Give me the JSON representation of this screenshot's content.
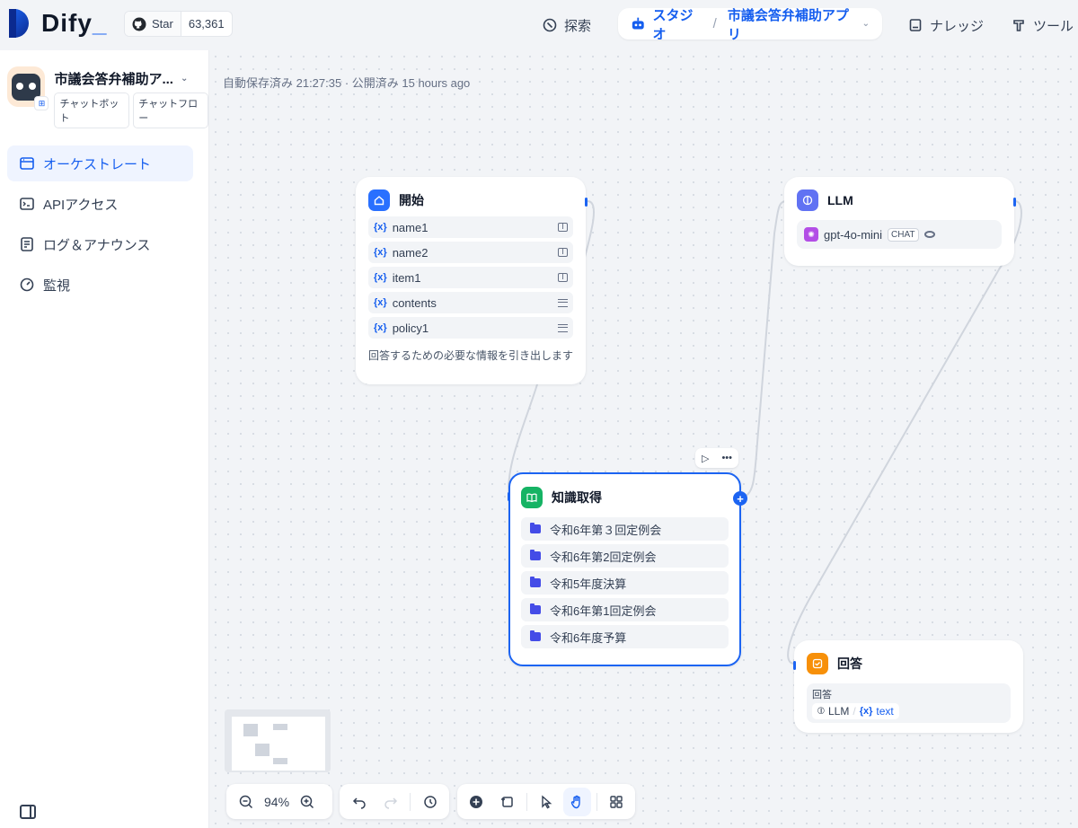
{
  "header": {
    "logo": "Dify",
    "github_star_label": "Star",
    "github_star_count": "63,361",
    "nav_explore": "探索",
    "nav_studio": "スタジオ",
    "breadcrumb_app": "市議会答弁補助アプリ",
    "nav_knowledge": "ナレッジ",
    "nav_tools": "ツール"
  },
  "sidebar": {
    "app_name": "市議会答弁補助ア...",
    "tags": [
      "チャットボット",
      "チャットフロー"
    ],
    "menu": [
      {
        "label": "オーケストレート",
        "icon": "layout-icon"
      },
      {
        "label": "APIアクセス",
        "icon": "terminal-icon"
      },
      {
        "label": "ログ＆アナウンス",
        "icon": "document-icon"
      },
      {
        "label": "監視",
        "icon": "gauge-icon"
      }
    ]
  },
  "canvas": {
    "autosave": "自動保存済み 21:27:35 · 公開済み 15 hours ago",
    "zoom": "94%"
  },
  "nodes": {
    "start": {
      "title": "開始",
      "vars": [
        {
          "name": "name1",
          "type": "text"
        },
        {
          "name": "name2",
          "type": "text"
        },
        {
          "name": "item1",
          "type": "text"
        },
        {
          "name": "contents",
          "type": "paragraph"
        },
        {
          "name": "policy1",
          "type": "paragraph"
        }
      ],
      "var_prefix": "{x}",
      "description": "回答するための必要な情報を引き出します"
    },
    "knowledge": {
      "title": "知識取得",
      "datasets": [
        "令和6年第３回定例会",
        "令和6年第2回定例会",
        "令和5年度決算",
        "令和6年第1回定例会",
        "令和6年度予算"
      ]
    },
    "llm": {
      "title": "LLM",
      "model": "gpt-4o-mini",
      "mode_badge": "CHAT"
    },
    "answer": {
      "title": "回答",
      "label": "回答",
      "source_node": "LLM",
      "source_var": "text",
      "var_prefix": "{x}"
    }
  },
  "colors": {
    "accent": "#155eef",
    "start_icon": "#2970ff",
    "knowledge_icon": "#16b364",
    "llm_icon": "#6172f3",
    "answer_icon": "#f79009"
  }
}
